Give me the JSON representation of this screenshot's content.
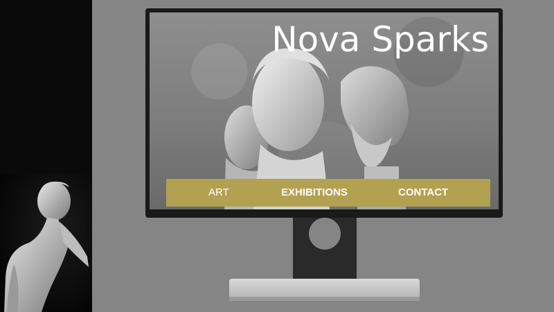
{
  "site": {
    "title": "Nova Sparks"
  },
  "nav": {
    "items": [
      {
        "label": "ART"
      },
      {
        "label": "EXHIBITIONS"
      },
      {
        "label": "CONTACT"
      }
    ]
  },
  "colors": {
    "background": "#858585",
    "left_panel": "#0a0a0a",
    "nav_bar": "#b3a152",
    "title_text": "#ffffff",
    "monitor_bezel": "#1a1a1a",
    "stand": "#2a2a2a",
    "stand_base": "#c4c4c4"
  },
  "images": {
    "left_statue": "statue-photo",
    "screen_background": "sculpture-busts-photo"
  }
}
